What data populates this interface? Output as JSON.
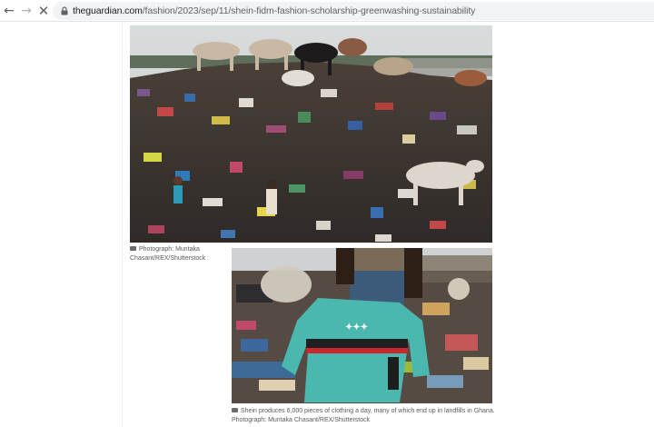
{
  "browser": {
    "url_host": "theguardian.com",
    "url_path": "/fashion/2023/sep/11/shein-fidm-fashion-scholarship-greenwashing-sustainability",
    "back_icon": "←",
    "forward_icon": "→",
    "stop_icon": "✕"
  },
  "article": {
    "photo1_caption": "Photograph: Muntaka Chasant/REX/Shutterstock",
    "photo2_caption": "Shein produces 6,000 pieces of clothing a day, many of which end up in landfills in Ghana.",
    "photo2_credit": "Photograph: Muntaka Chasant/REX/Shutterstock"
  },
  "colors": {
    "sky": "#cfd4d6",
    "trash_dark": "#2a2622",
    "shirt": "#47b6b0"
  }
}
